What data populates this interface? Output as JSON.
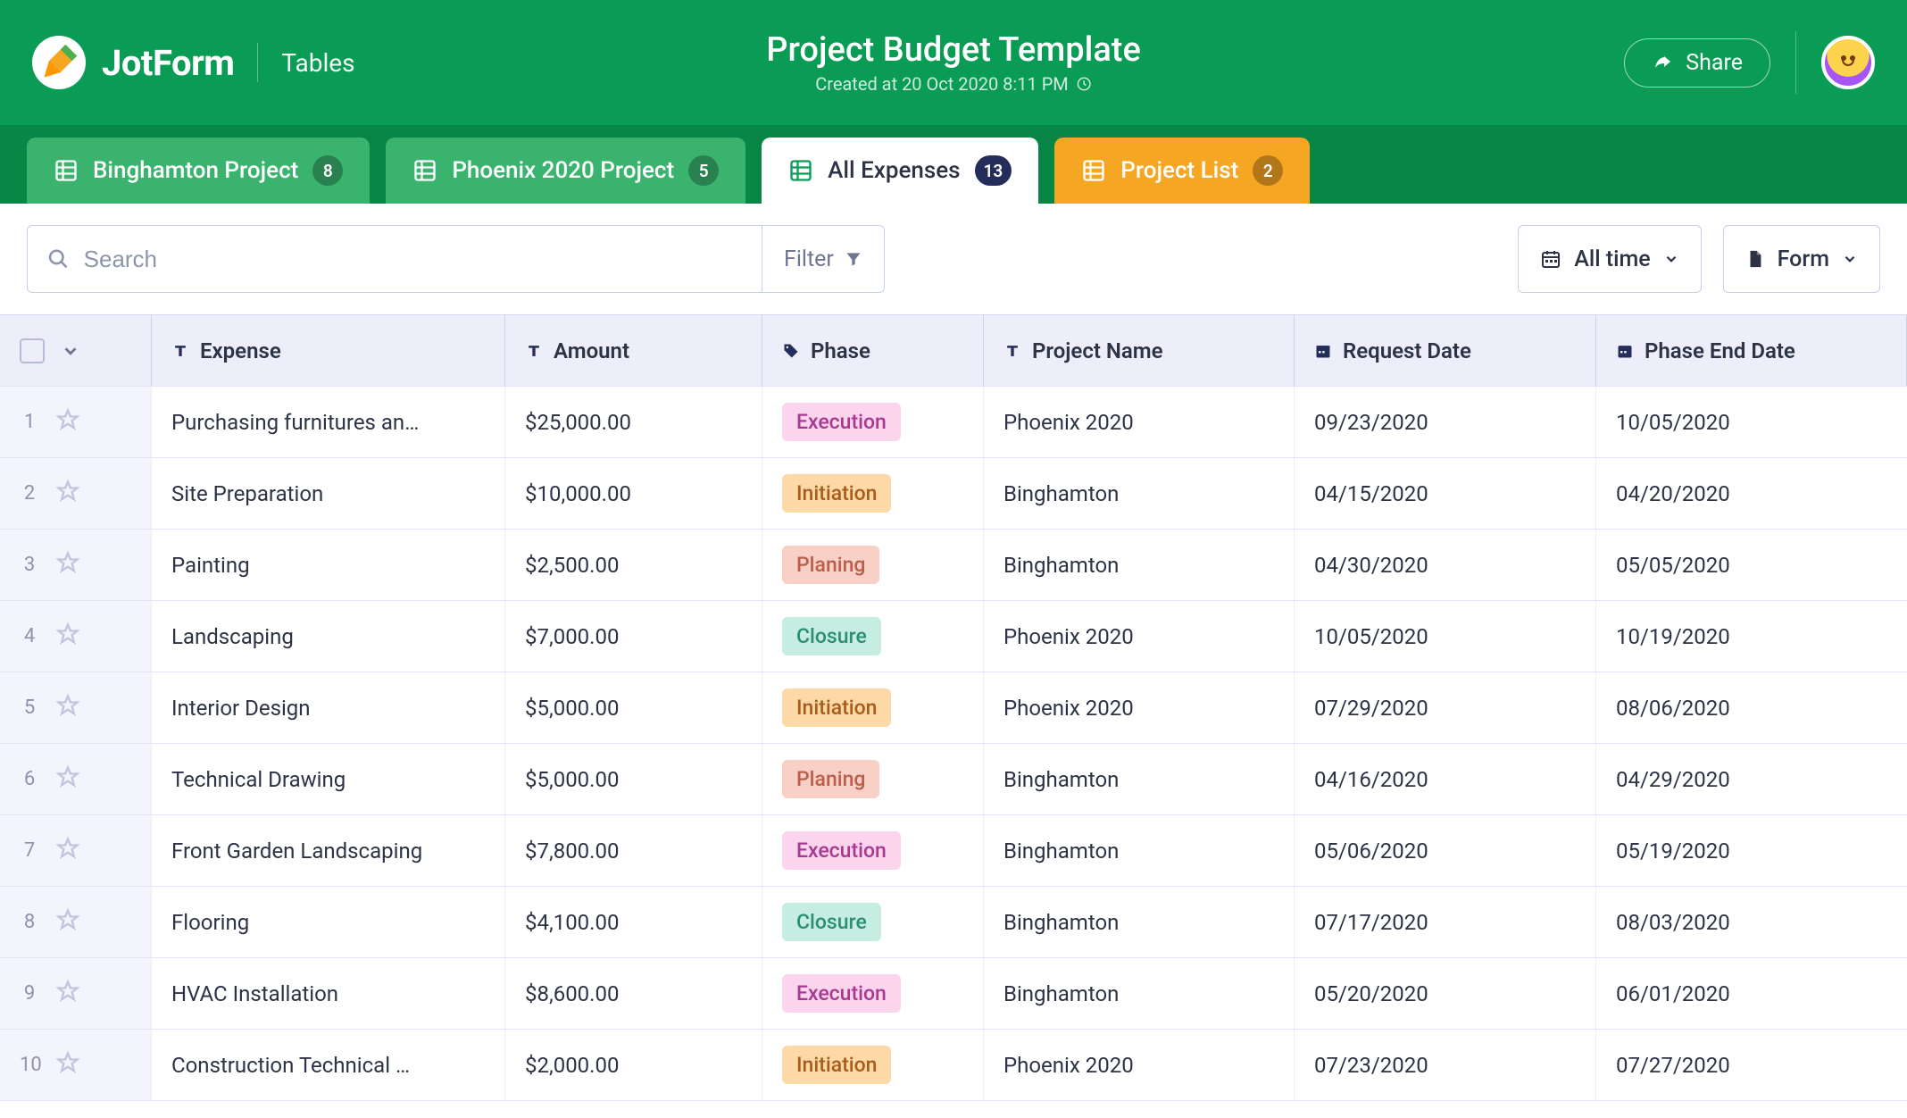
{
  "brand": {
    "name": "JotForm",
    "segment": "Tables"
  },
  "title": "Project Budget Template",
  "subtitle": "Created at 20 Oct 2020 8:11 PM",
  "share_label": "Share",
  "tabs": [
    {
      "label": "Binghamton Project",
      "count": "8",
      "kind": "green"
    },
    {
      "label": "Phoenix 2020 Project",
      "count": "5",
      "kind": "green"
    },
    {
      "label": "All Expenses",
      "count": "13",
      "kind": "active"
    },
    {
      "label": "Project List",
      "count": "2",
      "kind": "orange"
    }
  ],
  "toolbar": {
    "search_placeholder": "Search",
    "filter_label": "Filter",
    "timerange_label": "All time",
    "form_label": "Form"
  },
  "columns": {
    "expense": "Expense",
    "amount": "Amount",
    "phase": "Phase",
    "project": "Project Name",
    "reqdate": "Request Date",
    "enddate": "Phase End Date"
  },
  "rows": [
    {
      "n": "1",
      "expense": "Purchasing furnitures an…",
      "amount": "$25,000.00",
      "phase": "Execution",
      "project": "Phoenix 2020",
      "reqdate": "09/23/2020",
      "enddate": "10/05/2020"
    },
    {
      "n": "2",
      "expense": "Site Preparation",
      "amount": "$10,000.00",
      "phase": "Initiation",
      "project": "Binghamton",
      "reqdate": "04/15/2020",
      "enddate": "04/20/2020"
    },
    {
      "n": "3",
      "expense": "Painting",
      "amount": "$2,500.00",
      "phase": "Planing",
      "project": "Binghamton",
      "reqdate": "04/30/2020",
      "enddate": "05/05/2020"
    },
    {
      "n": "4",
      "expense": "Landscaping",
      "amount": "$7,000.00",
      "phase": "Closure",
      "project": "Phoenix 2020",
      "reqdate": "10/05/2020",
      "enddate": "10/19/2020"
    },
    {
      "n": "5",
      "expense": "Interior Design",
      "amount": "$5,000.00",
      "phase": "Initiation",
      "project": "Phoenix 2020",
      "reqdate": "07/29/2020",
      "enddate": "08/06/2020"
    },
    {
      "n": "6",
      "expense": "Technical Drawing",
      "amount": "$5,000.00",
      "phase": "Planing",
      "project": "Binghamton",
      "reqdate": "04/16/2020",
      "enddate": "04/29/2020"
    },
    {
      "n": "7",
      "expense": "Front Garden Landscaping",
      "amount": "$7,800.00",
      "phase": "Execution",
      "project": "Binghamton",
      "reqdate": "05/06/2020",
      "enddate": "05/19/2020"
    },
    {
      "n": "8",
      "expense": "Flooring",
      "amount": "$4,100.00",
      "phase": "Closure",
      "project": "Binghamton",
      "reqdate": "07/17/2020",
      "enddate": "08/03/2020"
    },
    {
      "n": "9",
      "expense": "HVAC Installation",
      "amount": "$8,600.00",
      "phase": "Execution",
      "project": "Binghamton",
      "reqdate": "05/20/2020",
      "enddate": "06/01/2020"
    },
    {
      "n": "10",
      "expense": "Construction Technical …",
      "amount": "$2,000.00",
      "phase": "Initiation",
      "project": "Phoenix 2020",
      "reqdate": "07/23/2020",
      "enddate": "07/27/2020"
    }
  ]
}
